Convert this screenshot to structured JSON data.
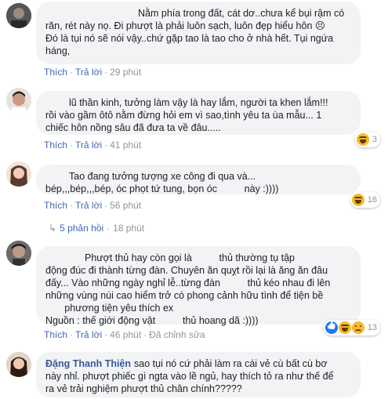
{
  "comments": [
    {
      "lines": [
        "Nằm phía trong đất, cát dơ..chưa kể bụi rậm có",
        "răn, rét này nọ. Đi phượt là phải luôn sạch, luôn đẹp hiểu hôn 😣",
        "Đó là tụi nó sẽ nói vậy..chứ gặp tao là tao cho ở nhà hết. Tụi ngứa",
        "háng,"
      ],
      "actions": {
        "like": "Thích",
        "reply": "Trả lời",
        "time": "29 phút"
      }
    },
    {
      "lines": [
        "lũ thần kinh, tưởng làm vậy là hay lắm, người ta khen lắm!!!",
        "rồi vào gầm ôtô nằm đừng hỏi em vì sao,tình yêu ta ùa mẫu... 1",
        "chiếc hôn nồng sâu đã đưa ta về đâu....."
      ],
      "actions": {
        "like": "Thích",
        "reply": "Trả lời",
        "time": "41 phút"
      },
      "reaction_count": "3"
    },
    {
      "lines": [
        "Tao đang tưởng tượng xe công đi qua và...",
        "bép,,,bép,,,bép, óc phọt tứ tung, bọn óc          này :))))"
      ],
      "actions": {
        "like": "Thích",
        "reply": "Trả lời",
        "time": "56 phút"
      },
      "reaction_count": "16"
    },
    {
      "lines": [
        "Phượt thủ hay còn gọi là          thủ thường tụ tập",
        "động đúc đi thành từng đàn. Chuyên ăn quỵt rồi lại là ăng ăn đâu",
        "đấy... Vào những ngày nghỉ lễ..từng đàn          thủ kéo nhau đi lên",
        "những vùng núi cao hiểm trở có phong cảnh hữu tình để tiện bề",
        "       phương tiện yêu thích ex",
        "Nguồn : thế giới động vật          thủ hoang dã :))))"
      ],
      "actions": {
        "like": "Thích",
        "reply": "Trả lời",
        "time": "46 phút",
        "edited": "Đã chỉnh sửa"
      },
      "reaction_count": "13"
    },
    {
      "author": "Đặng Thanh Thiện",
      "lines": [
        "sao tụi nó cứ phải làm ra cái vẻ cù bất cù bơ",
        "này nhỉ. phượt phiếc gì ngta vào lề ngủ, hay thích tỏ ra như thế để",
        "ra vẻ trải nghiệm phượt thủ chân chính?????"
      ]
    }
  ],
  "replies_link": {
    "label": "5 phản hồi",
    "time": "18 phút"
  },
  "colors": {
    "link": "#4267b2",
    "author": "#385898",
    "bubble": "#f2f3f5"
  }
}
